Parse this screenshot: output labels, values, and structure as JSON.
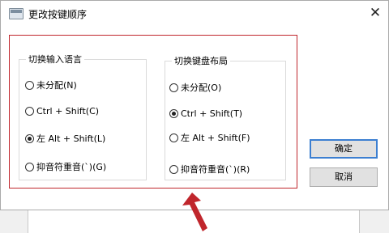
{
  "window": {
    "title": "更改按键顺序",
    "close_glyph": "✕"
  },
  "groups": {
    "input_language": {
      "legend": "切换输入语言",
      "options": [
        {
          "label": "未分配(N)",
          "checked": false
        },
        {
          "label": "Ctrl + Shift(C)",
          "checked": false
        },
        {
          "label": "左 Alt + Shift(L)",
          "checked": true
        },
        {
          "label": "抑音符重音(`)(G)",
          "checked": false
        }
      ]
    },
    "keyboard_layout": {
      "legend": "切换键盘布局",
      "options": [
        {
          "label": "未分配(O)",
          "checked": false
        },
        {
          "label": "Ctrl + Shift(T)",
          "checked": true
        },
        {
          "label": "左 Alt + Shift(F)",
          "checked": false
        },
        {
          "label": "抑音符重音(`)(R)",
          "checked": false
        }
      ]
    }
  },
  "buttons": {
    "ok": "确定",
    "cancel": "取消"
  },
  "annotation": {
    "color": "#c0262c",
    "icon": "red-arrow-icon"
  }
}
